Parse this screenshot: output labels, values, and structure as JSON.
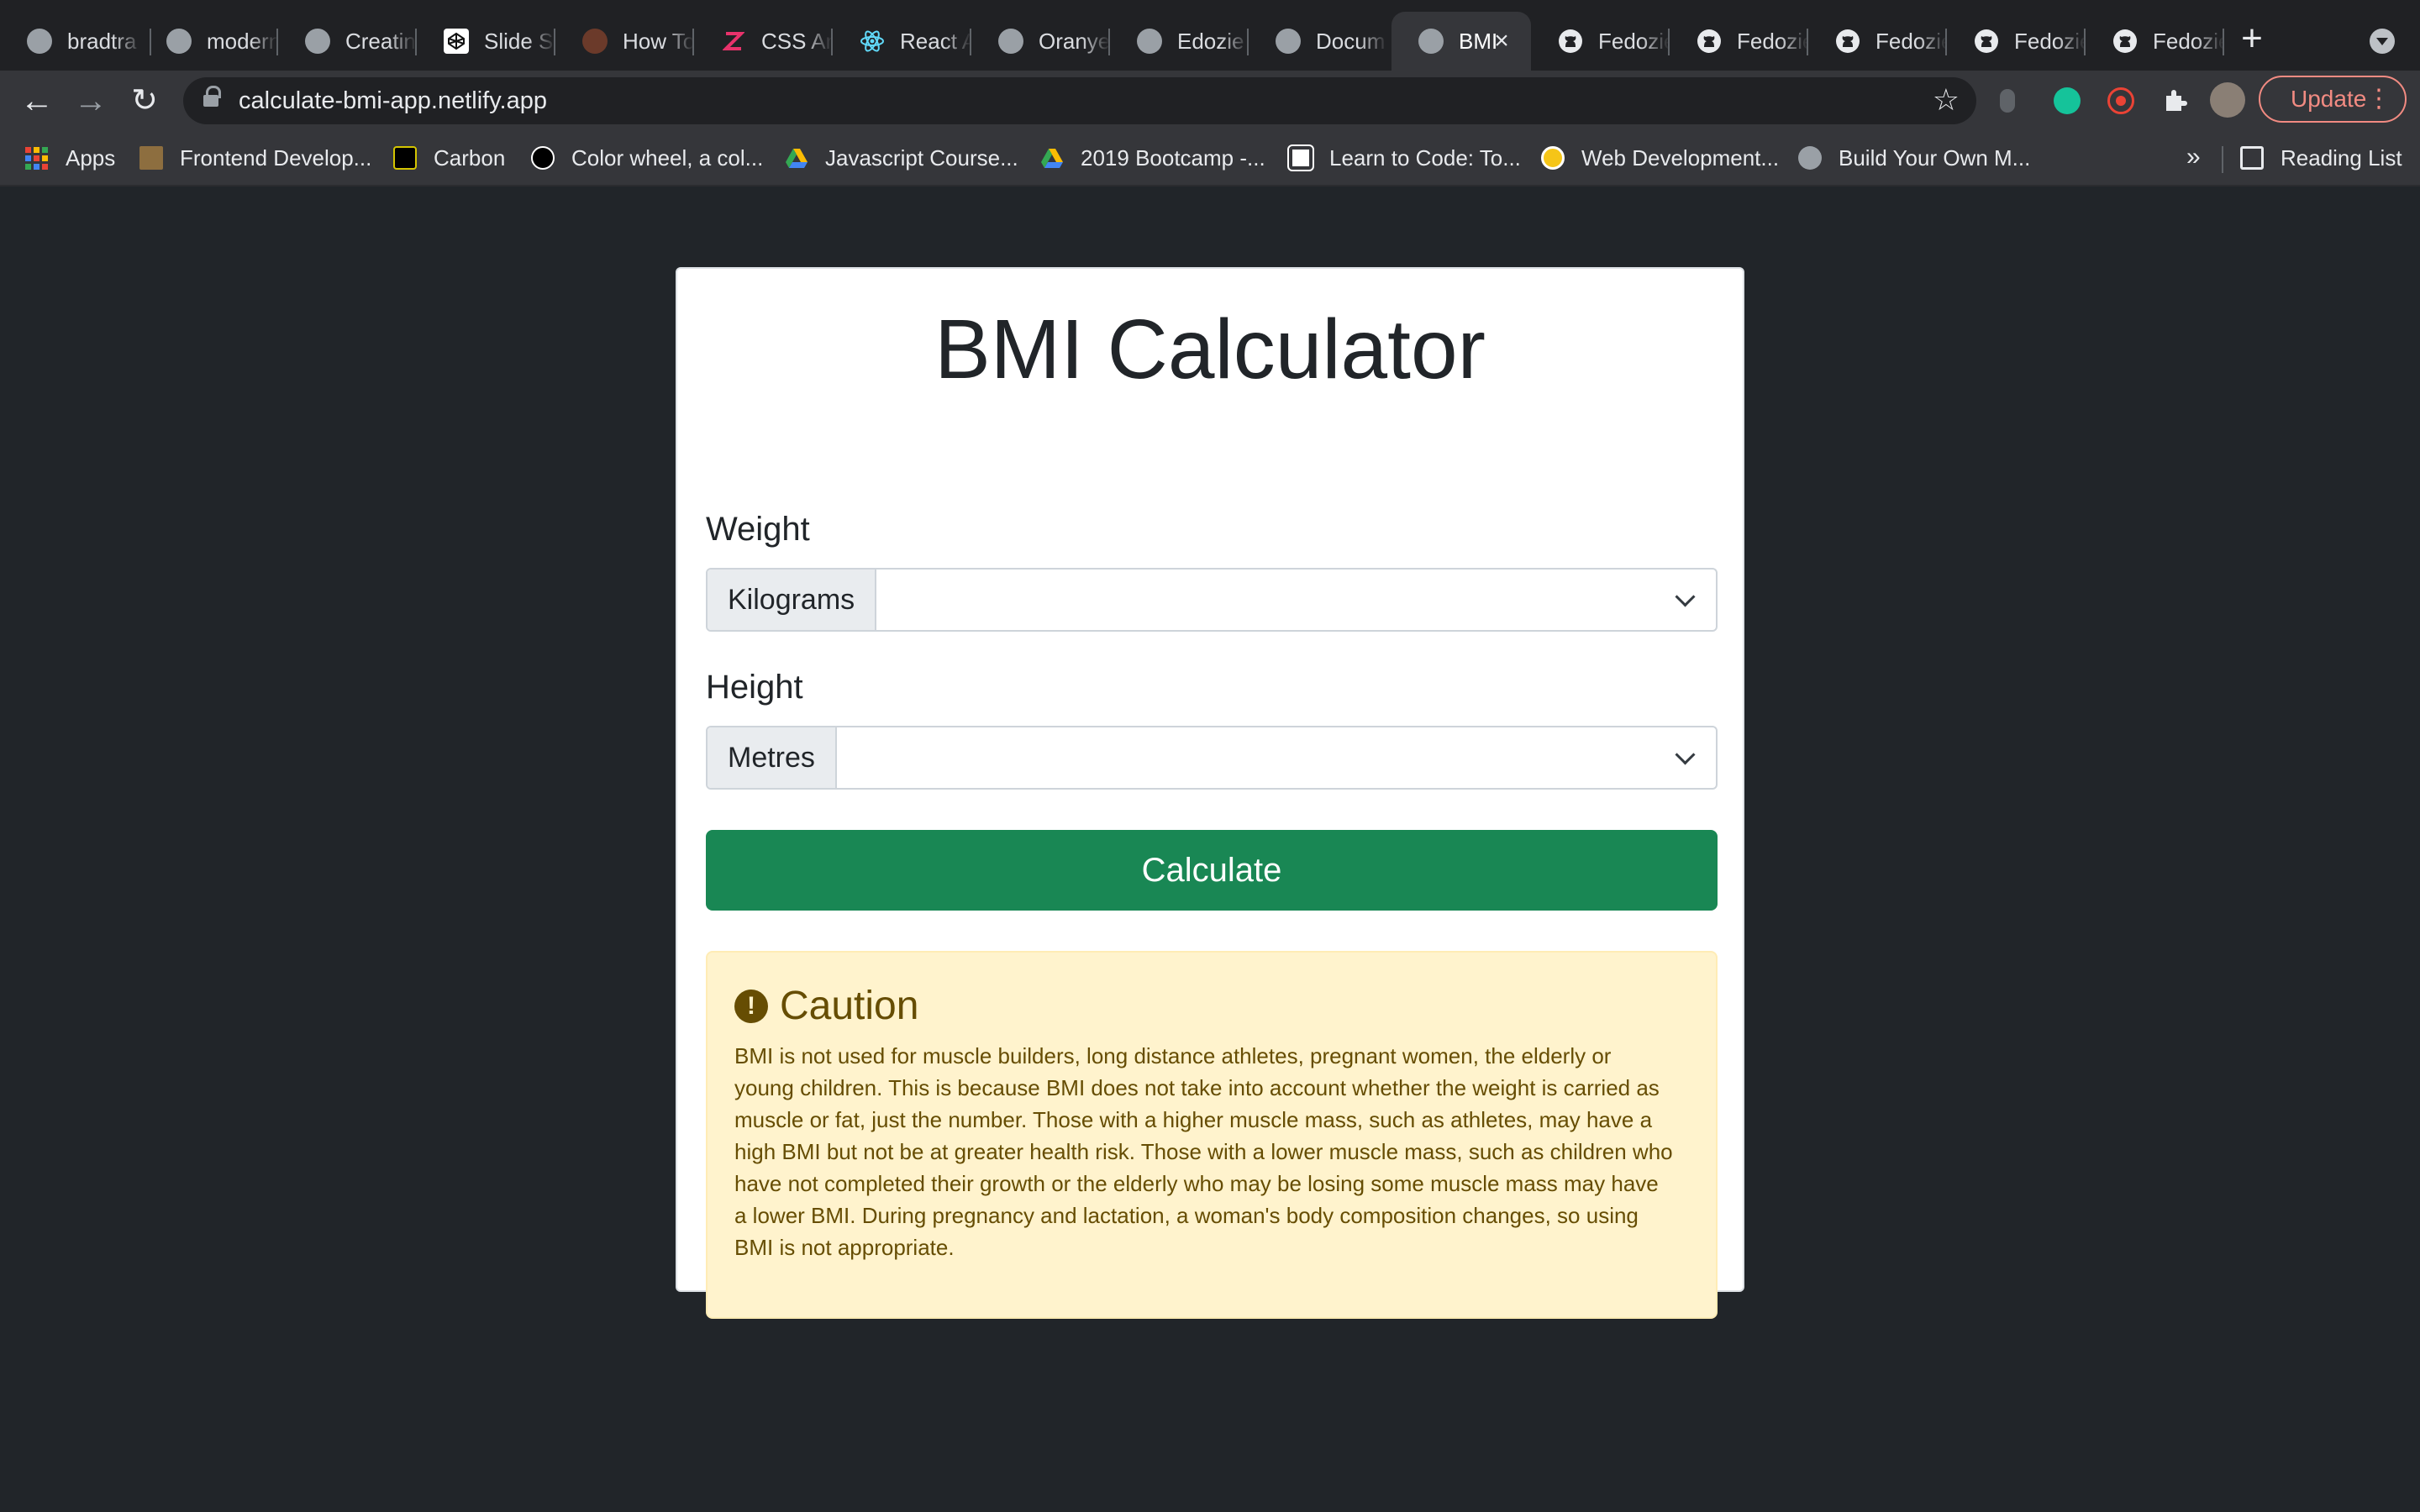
{
  "browser": {
    "tabs": [
      {
        "title": "bradtra",
        "icon": "globe-icon"
      },
      {
        "title": "modern",
        "icon": "globe-icon"
      },
      {
        "title": "Creatin",
        "icon": "globe-icon"
      },
      {
        "title": "Slide Sl",
        "icon": "codepen-icon"
      },
      {
        "title": "How To",
        "icon": "avatar-icon"
      },
      {
        "title": "CSS An",
        "icon": "zeplin-icon"
      },
      {
        "title": "React A",
        "icon": "react-icon"
      },
      {
        "title": "Oranye",
        "icon": "globe-icon"
      },
      {
        "title": "Edozie",
        "icon": "globe-icon"
      },
      {
        "title": "Docum",
        "icon": "globe-icon"
      },
      {
        "title": "BMI",
        "icon": "globe-icon",
        "active": true
      },
      {
        "title": "Fedozie",
        "icon": "github-icon"
      },
      {
        "title": "Fedozie",
        "icon": "github-icon"
      },
      {
        "title": "Fedozie",
        "icon": "github-icon"
      },
      {
        "title": "Fedozie",
        "icon": "github-icon"
      },
      {
        "title": "Fedozie",
        "icon": "github-icon"
      }
    ],
    "url": "calculate-bmi-app.netlify.app",
    "update_label": "Update",
    "bookmarks": [
      {
        "label": "Apps",
        "icon": "apps-grid-icon"
      },
      {
        "label": "Frontend Develop...",
        "icon": "graduation-cap-icon"
      },
      {
        "label": "Carbon",
        "icon": "carbon-icon"
      },
      {
        "label": "Color wheel, a col...",
        "icon": "color-wheel-icon"
      },
      {
        "label": "Javascript Course...",
        "icon": "google-drive-icon"
      },
      {
        "label": "2019 Bootcamp -...",
        "icon": "google-drive-icon"
      },
      {
        "label": "Learn to Code: To...",
        "icon": "freecodecamp-icon"
      },
      {
        "label": "Web Development...",
        "icon": "udemy-icon"
      },
      {
        "label": "Build Your Own M...",
        "icon": "globe-icon"
      }
    ],
    "more_bookmarks": "»",
    "reading_list": "Reading List"
  },
  "app": {
    "title": "BMI Calculator",
    "weight": {
      "label": "Weight",
      "unit": "Kilograms",
      "value": ""
    },
    "height": {
      "label": "Height",
      "unit": "Metres",
      "value": ""
    },
    "calculate_label": "Calculate",
    "caution": {
      "title": "Caution",
      "icon_glyph": "!",
      "body": "BMI is not used for muscle builders, long distance athletes, pregnant women, the elderly or young children. This is because BMI does not take into account whether the weight is carried as muscle or fat, just the number. Those with a higher muscle mass, such as athletes, may have a high BMI but not be at greater health risk. Those with a lower muscle mass, such as children who have not completed their growth or the elderly who may be losing some muscle mass may have a lower BMI. During pregnancy and lactation, a woman's body composition changes, so using BMI is not appropriate."
    }
  },
  "colors": {
    "page_bg": "#212529",
    "button_green": "#198754",
    "alert_bg": "#fff3cd",
    "alert_text": "#664d03",
    "update_red": "#f28b82"
  }
}
